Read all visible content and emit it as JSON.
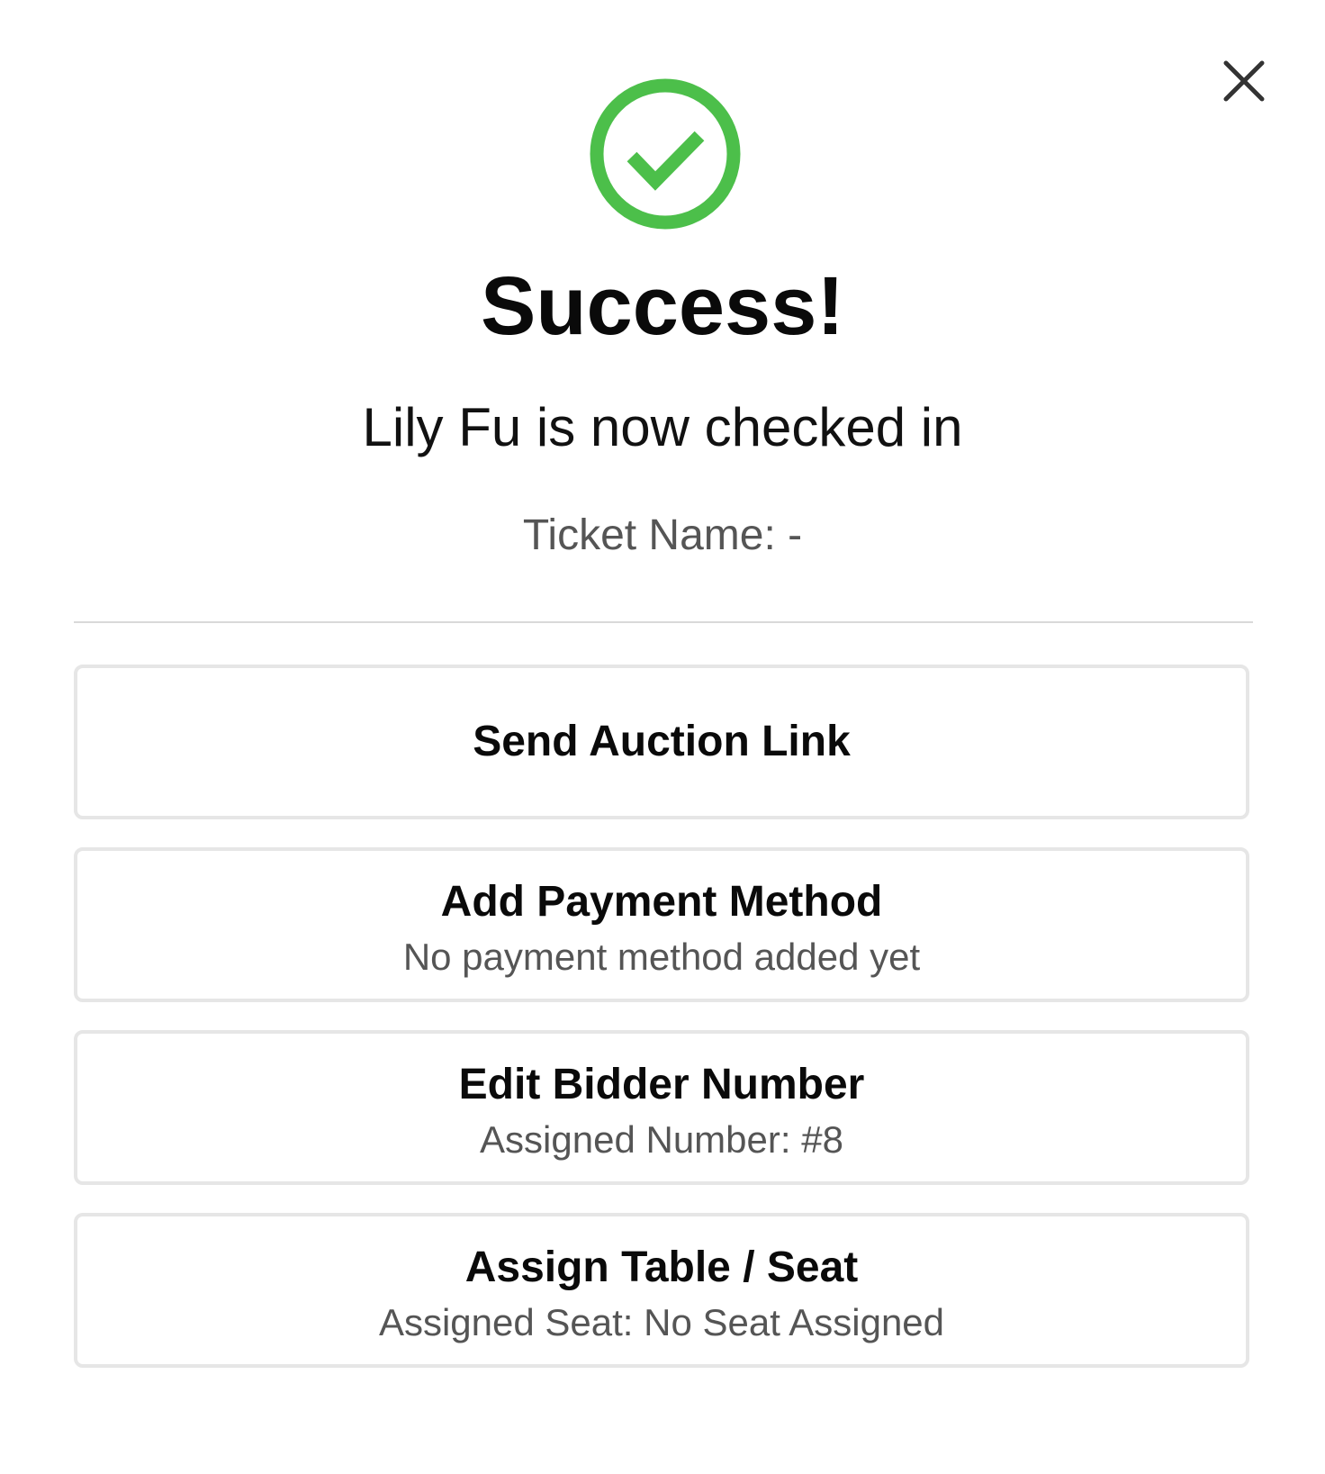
{
  "modal": {
    "close_icon": "close-icon",
    "status_icon": "check-circle-icon",
    "accent_color": "#4cbf4a",
    "title": "Success!",
    "message": "Lily Fu is now checked in",
    "ticket_name": "Ticket Name: -"
  },
  "actions": [
    {
      "label": "Send Auction Link",
      "sublabel": ""
    },
    {
      "label": "Add Payment Method",
      "sublabel": "No payment method added yet"
    },
    {
      "label": "Edit Bidder Number",
      "sublabel": "Assigned Number: #8"
    },
    {
      "label": "Assign Table / Seat",
      "sublabel": "Assigned Seat: No Seat Assigned"
    }
  ]
}
